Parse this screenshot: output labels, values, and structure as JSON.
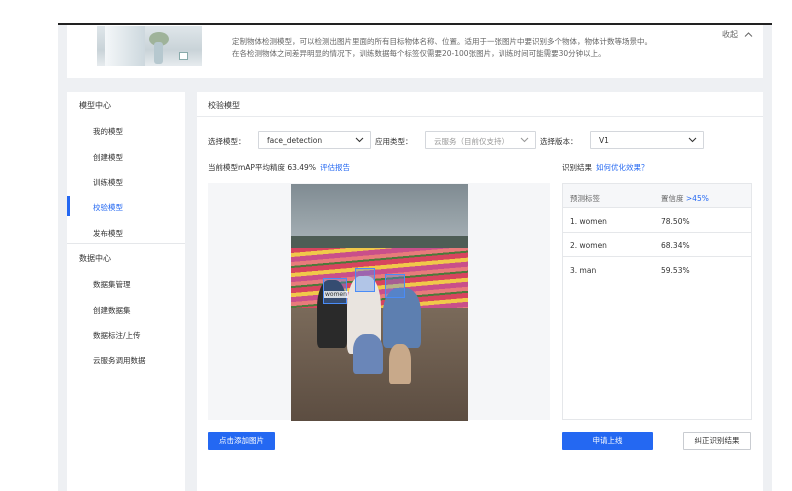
{
  "intro": {
    "line1": "定制物体检测模型，可以检测出图片里面的所有目标物体名称、位置。适用于一张图片中要识别多个物体，物体计数等场景中。",
    "line2": "在各检测物体之间差异明显的情况下，训练数据每个标签仅需要20-100张图片，训练时间可能需要30分钟以上。",
    "collapse_label": "收起"
  },
  "sidebar": {
    "group1": "模型中心",
    "group1_items": [
      "我的模型",
      "创建模型",
      "训练模型",
      "校验模型",
      "发布模型"
    ],
    "group2": "数据中心",
    "group2_items": [
      "数据集管理",
      "创建数据集",
      "数据标注/上传",
      "云服务调用数据"
    ],
    "active_item": "校验模型"
  },
  "main": {
    "title": "校验模型",
    "model_label": "选择模型：",
    "model_value": "face_detection",
    "app_type_label": "应用类型：",
    "app_type_value": "云服务（目前仅支持）",
    "version_label": "选择版本：",
    "version_value": "V1",
    "map_text": "当前模型mAP平均精度 63.49%",
    "map_link": "评估报告",
    "result_label": "识别结果",
    "result_link": "如何优化效果？",
    "face_tag": "women"
  },
  "results": {
    "col_label": "预测标签",
    "col_conf": "置信度",
    "col_conf_filter": ">45%",
    "rows": [
      {
        "label": "1. women",
        "confidence": "78.50%"
      },
      {
        "label": "2. women",
        "confidence": "68.34%"
      },
      {
        "label": "3. man",
        "confidence": "59.53%"
      }
    ]
  },
  "buttons": {
    "add_image": "点击添加图片",
    "apply_online": "申请上线",
    "correct_result": "纠正识别结果"
  },
  "colors": {
    "accent": "#2468f2",
    "background": "#eef0f3"
  }
}
